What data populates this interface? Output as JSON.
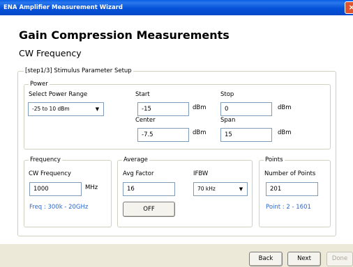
{
  "window": {
    "title": "ENA Amplifier Measurement Wizard",
    "close_glyph": "×"
  },
  "header": {
    "title": "Gain Compression Measurements",
    "subtitle": "CW Frequency"
  },
  "step_group": {
    "legend": "[step1/3] Stimulus Parameter Setup"
  },
  "power": {
    "legend": "Power",
    "select_range_label": "Select Power Range",
    "range_value": "-25 to 10 dBm",
    "start_label": "Start",
    "start_value": "-15",
    "stop_label": "Stop",
    "stop_value": "0",
    "center_label": "Center",
    "center_value": "-7.5",
    "span_label": "Span",
    "span_value": "15",
    "unit": "dBm"
  },
  "frequency": {
    "legend": "Frequency",
    "cw_label": "CW Frequency",
    "cw_value": "1000",
    "unit": "MHz",
    "range_note": "Freq : 300k - 20GHz"
  },
  "average": {
    "legend": "Average",
    "factor_label": "Avg Factor",
    "factor_value": "16",
    "ifbw_label": "IFBW",
    "ifbw_value": "70 kHz",
    "toggle_label": "OFF"
  },
  "points": {
    "legend": "Points",
    "count_label": "Number of Points",
    "count_value": "201",
    "range_note": "Point : 2 - 1601"
  },
  "footer": {
    "back_label": "Back",
    "next_label": "Next",
    "done_label": "Done"
  },
  "colors": {
    "titlebar": "#0551d8",
    "note_blue": "#2a66c8",
    "dialog_bg": "#ece9d8"
  }
}
